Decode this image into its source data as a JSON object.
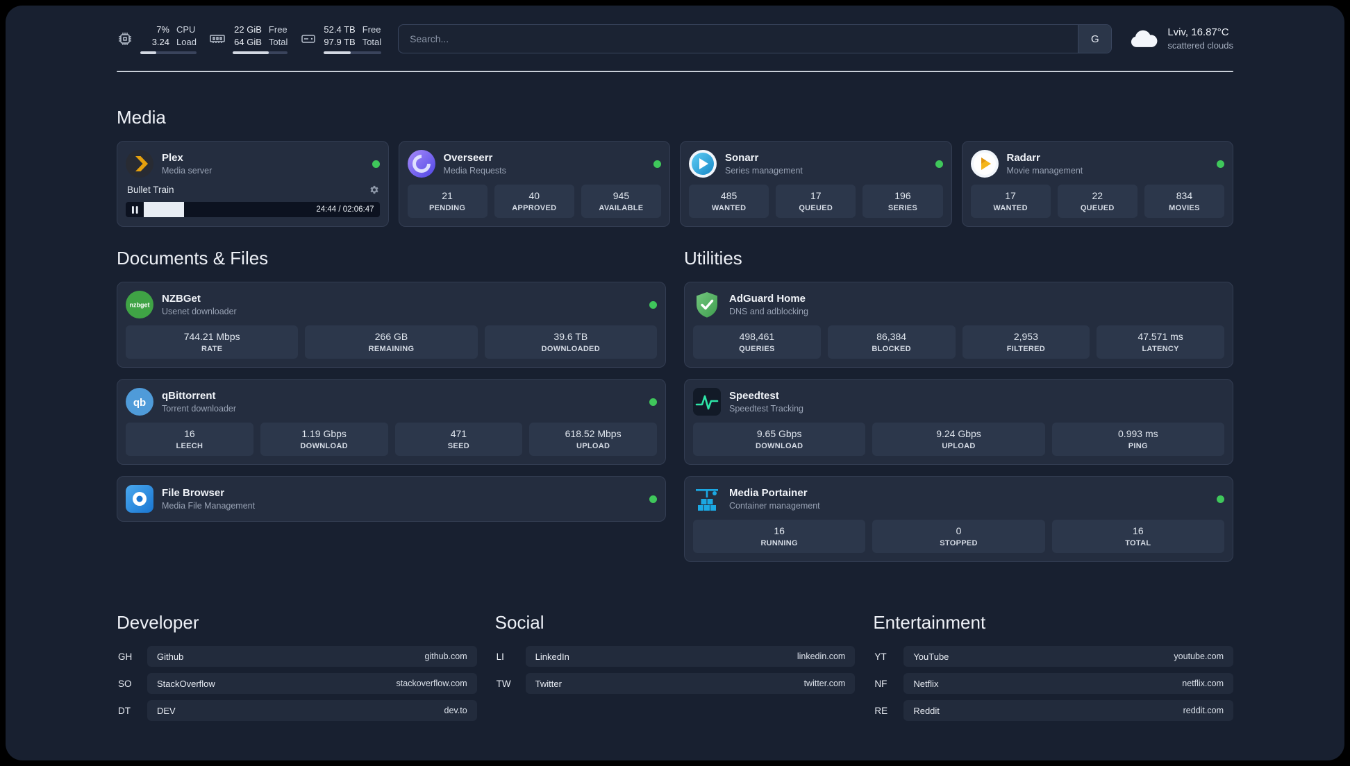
{
  "topbar": {
    "cpu": {
      "value1": "7%",
      "value2": "3.24",
      "label1": "CPU",
      "label2": "Load",
      "progress": 28
    },
    "ram": {
      "value1": "22 GiB",
      "value2": "64 GiB",
      "label1": "Free",
      "label2": "Total",
      "progress": 66
    },
    "disk": {
      "value1": "52.4 TB",
      "value2": "97.9 TB",
      "label1": "Free",
      "label2": "Total",
      "progress": 47
    },
    "search": {
      "placeholder": "Search...",
      "button": "G"
    },
    "weather": {
      "location": "Lviv, 16.87°C",
      "condition": "scattered clouds"
    }
  },
  "media": {
    "title": "Media",
    "plex": {
      "name": "Plex",
      "subtitle": "Media server",
      "now_playing": "Bullet Train",
      "time": "24:44 / 02:06:47",
      "progress": 17
    },
    "overseerr": {
      "name": "Overseerr",
      "subtitle": "Media Requests",
      "stats": [
        {
          "value": "21",
          "label": "PENDING"
        },
        {
          "value": "40",
          "label": "APPROVED"
        },
        {
          "value": "945",
          "label": "AVAILABLE"
        }
      ]
    },
    "sonarr": {
      "name": "Sonarr",
      "subtitle": "Series management",
      "stats": [
        {
          "value": "485",
          "label": "WANTED"
        },
        {
          "value": "17",
          "label": "QUEUED"
        },
        {
          "value": "196",
          "label": "SERIES"
        }
      ]
    },
    "radarr": {
      "name": "Radarr",
      "subtitle": "Movie management",
      "stats": [
        {
          "value": "17",
          "label": "WANTED"
        },
        {
          "value": "22",
          "label": "QUEUED"
        },
        {
          "value": "834",
          "label": "MOVIES"
        }
      ]
    }
  },
  "documents": {
    "title": "Documents & Files",
    "nzbget": {
      "name": "NZBGet",
      "subtitle": "Usenet downloader",
      "icon_text": "nzbget",
      "stats": [
        {
          "value": "744.21 Mbps",
          "label": "RATE"
        },
        {
          "value": "266 GB",
          "label": "REMAINING"
        },
        {
          "value": "39.6 TB",
          "label": "DOWNLOADED"
        }
      ]
    },
    "qbittorrent": {
      "name": "qBittorrent",
      "subtitle": "Torrent downloader",
      "icon_text": "qb",
      "stats": [
        {
          "value": "16",
          "label": "LEECH"
        },
        {
          "value": "1.19 Gbps",
          "label": "DOWNLOAD"
        },
        {
          "value": "471",
          "label": "SEED"
        },
        {
          "value": "618.52 Mbps",
          "label": "UPLOAD"
        }
      ]
    },
    "filebrowser": {
      "name": "File Browser",
      "subtitle": "Media File Management"
    }
  },
  "utilities": {
    "title": "Utilities",
    "adguard": {
      "name": "AdGuard Home",
      "subtitle": "DNS and adblocking",
      "stats": [
        {
          "value": "498,461",
          "label": "QUERIES"
        },
        {
          "value": "86,384",
          "label": "BLOCKED"
        },
        {
          "value": "2,953",
          "label": "FILTERED"
        },
        {
          "value": "47.571 ms",
          "label": "LATENCY"
        }
      ]
    },
    "speedtest": {
      "name": "Speedtest",
      "subtitle": "Speedtest Tracking",
      "stats": [
        {
          "value": "9.65 Gbps",
          "label": "DOWNLOAD"
        },
        {
          "value": "9.24 Gbps",
          "label": "UPLOAD"
        },
        {
          "value": "0.993 ms",
          "label": "PING"
        }
      ]
    },
    "portainer": {
      "name": "Media Portainer",
      "subtitle": "Container management",
      "stats": [
        {
          "value": "16",
          "label": "RUNNING"
        },
        {
          "value": "0",
          "label": "STOPPED"
        },
        {
          "value": "16",
          "label": "TOTAL"
        }
      ]
    }
  },
  "bookmarks": {
    "developer": {
      "title": "Developer",
      "items": [
        {
          "abbr": "GH",
          "name": "Github",
          "url": "github.com"
        },
        {
          "abbr": "SO",
          "name": "StackOverflow",
          "url": "stackoverflow.com"
        },
        {
          "abbr": "DT",
          "name": "DEV",
          "url": "dev.to"
        }
      ]
    },
    "social": {
      "title": "Social",
      "items": [
        {
          "abbr": "LI",
          "name": "LinkedIn",
          "url": "linkedin.com"
        },
        {
          "abbr": "TW",
          "name": "Twitter",
          "url": "twitter.com"
        }
      ]
    },
    "entertainment": {
      "title": "Entertainment",
      "items": [
        {
          "abbr": "YT",
          "name": "YouTube",
          "url": "youtube.com"
        },
        {
          "abbr": "NF",
          "name": "Netflix",
          "url": "netflix.com"
        },
        {
          "abbr": "RE",
          "name": "Reddit",
          "url": "reddit.com"
        }
      ]
    }
  }
}
